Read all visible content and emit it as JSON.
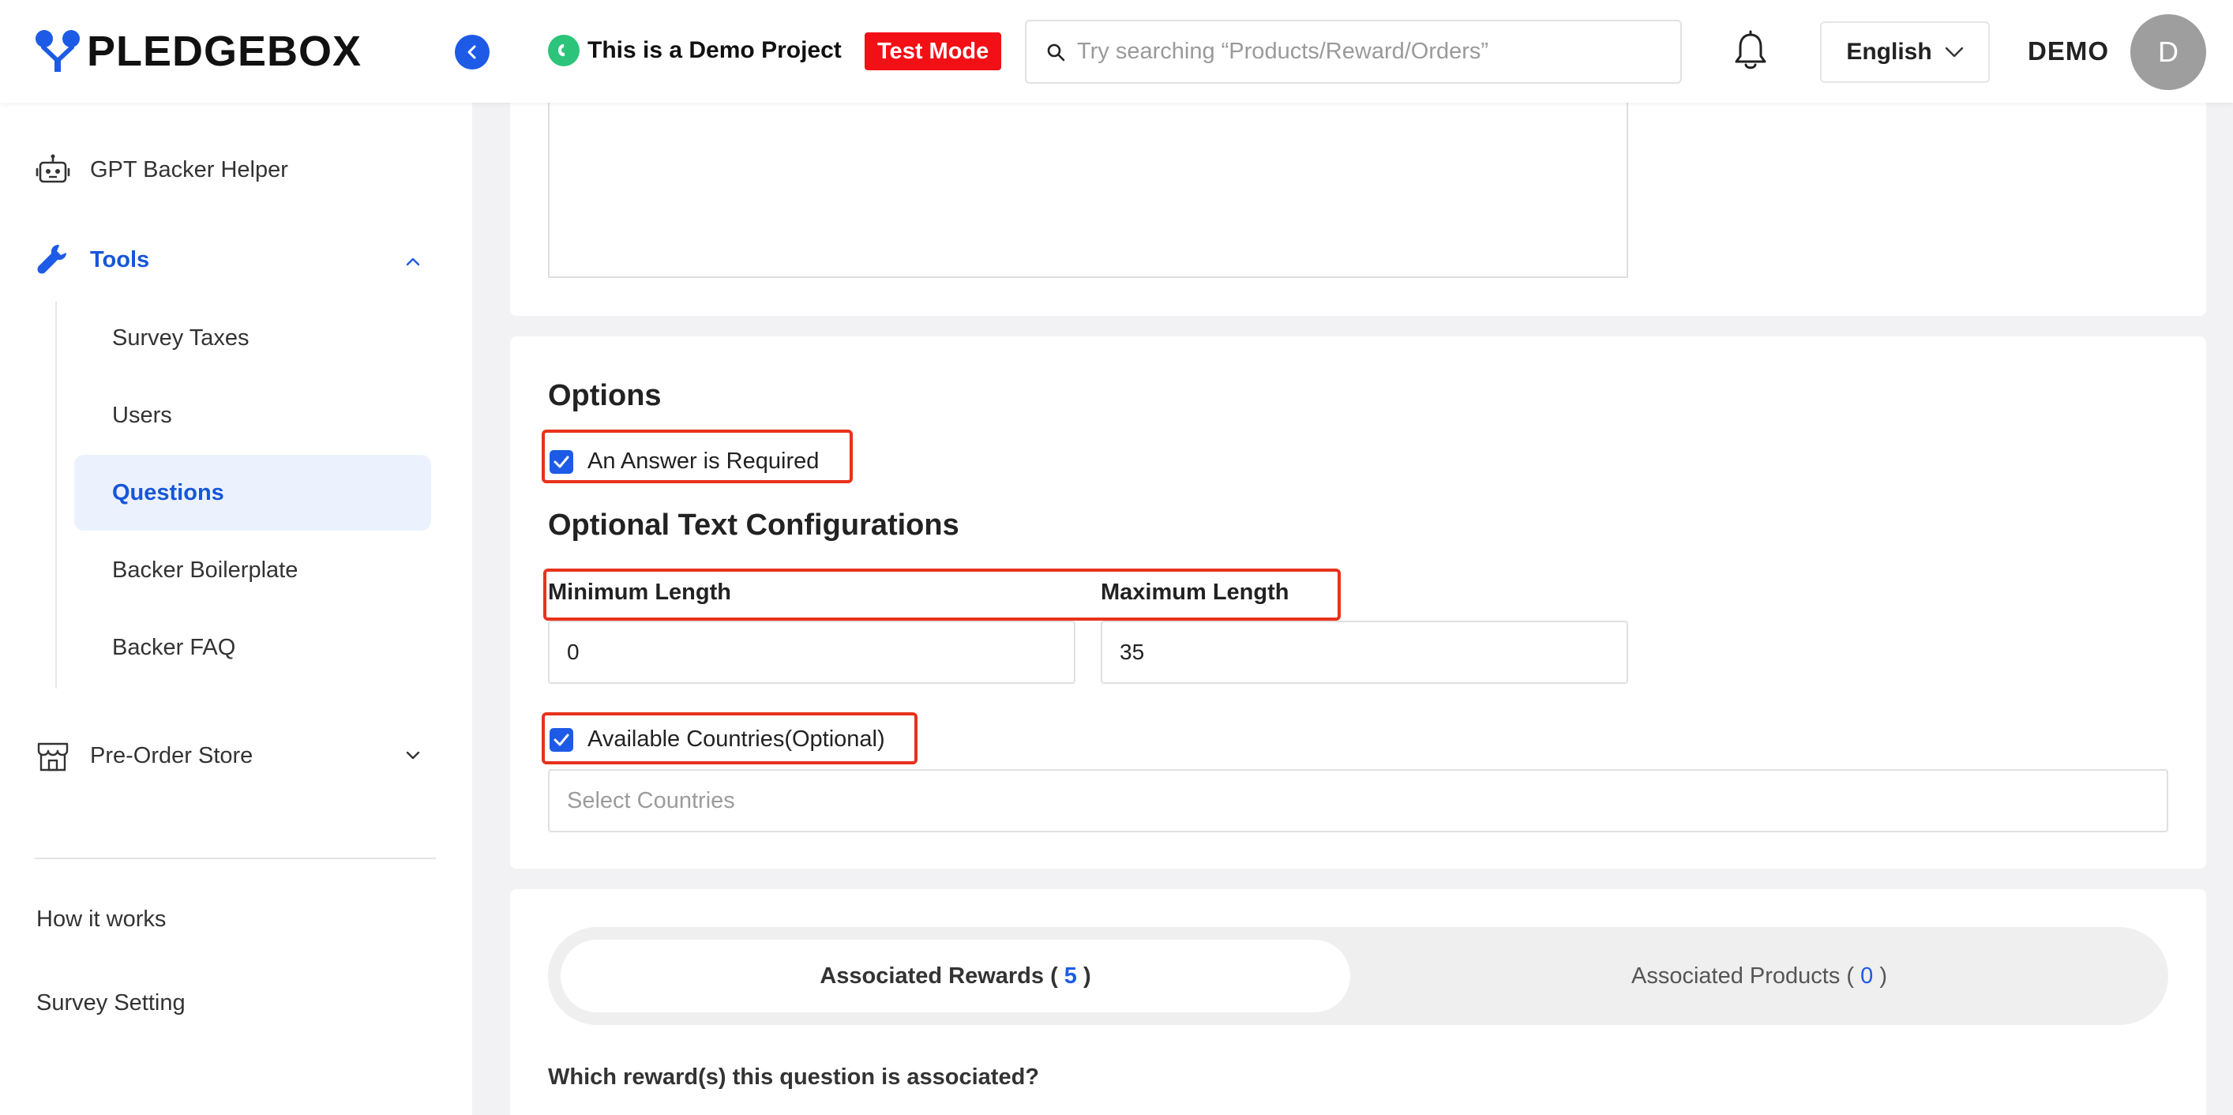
{
  "header": {
    "logo_text": "PLEDGEBOX",
    "project_name": "This is a Demo Project",
    "mode_badge": "Test Mode",
    "search_placeholder": "Try searching “Products/Reward/Orders”",
    "language": "English",
    "user_name": "DEMO",
    "avatar_initial": "D"
  },
  "sidebar": {
    "gpt_helper": "GPT Backer Helper",
    "tools": "Tools",
    "tools_sub": [
      "Survey Taxes",
      "Users",
      "Questions",
      "Backer Boilerplate",
      "Backer FAQ"
    ],
    "active_sub": "Questions",
    "pre_order_store": "Pre-Order Store",
    "how_it_works": "How it works",
    "survey_setting": "Survey Setting"
  },
  "options": {
    "title": "Options",
    "answer_required_label": "An Answer is Required",
    "answer_required_checked": true
  },
  "text_config": {
    "title": "Optional Text Configurations",
    "min_label": "Minimum Length",
    "min_value": "0",
    "max_label": "Maximum Length",
    "max_value": "35",
    "countries_label": "Available Countries(Optional)",
    "countries_checked": true,
    "countries_placeholder": "Select Countries"
  },
  "associations": {
    "rewards_prefix": "Associated Rewards ( ",
    "rewards_count": "5",
    "rewards_suffix": " )",
    "products_prefix": "Associated Products ( ",
    "products_count": "0",
    "products_suffix": " )",
    "question": "Which reward(s) this question is associated?"
  },
  "colors": {
    "primary": "#1d5be6",
    "danger": "#f20f15",
    "highlight": "#e8321c",
    "project_icon": "#2cc47a"
  },
  "icons": {
    "logo": "pledgebox-logo-icon",
    "collapse": "chevron-left-icon",
    "search": "search-icon",
    "bell": "bell-icon",
    "robot": "robot-icon",
    "wrench": "wrench-icon",
    "store": "store-icon"
  }
}
